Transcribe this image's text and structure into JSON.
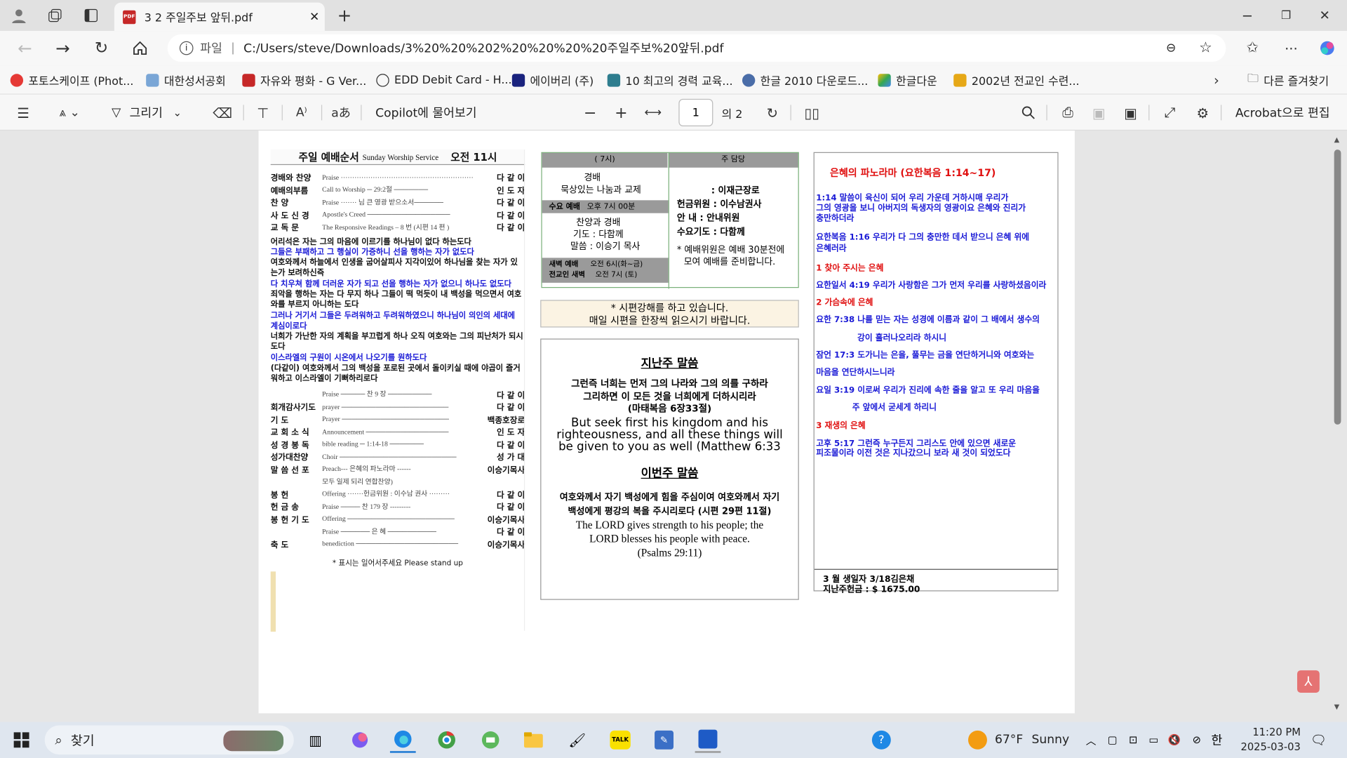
{
  "browser": {
    "tab_title": "3 2 주일주보 앞뒤.pdf",
    "address_prefix": "파일",
    "url": "C:/Users/steve/Downloads/3%20%20%202%20%20%20%20주일주보%20앞뒤.pdf"
  },
  "favorites": [
    "포토스케이프 (Phot...",
    "대한성서공회",
    "자유와 평화 - G Ver...",
    "EDD Debit Card - H...",
    "에이버리 (주)",
    "10 최고의 경력 교육...",
    "한글 2010 다운로드...",
    "한글다운",
    "2002년 전교인 수련...",
    "다른 즐겨찾기"
  ],
  "pdf_toolbar": {
    "draw": "그리기",
    "copilot": "Copilot에 물어보기",
    "page": "1",
    "of_pages": "의 2",
    "acrobat": "Acrobat으로 편집"
  },
  "left": {
    "header_title": "주일 예배순서",
    "header_en": "Sunday Worship Service",
    "header_time": "오전 11시",
    "order1": [
      {
        "a": "경배와 찬양",
        "b": "Praise ··························································",
        "c": "다 같 이"
      },
      {
        "a": "예배의부름",
        "b": "Call to Worship ─          29:2절  ───────",
        "c": "인 도 자"
      },
      {
        "a": "찬     양",
        "b": "Praise ·······   님 큰 영광 받으소서──────",
        "c": "다 같 이"
      },
      {
        "a": "사 도 신 경",
        "b": "Apostle's Creed ─────────────────",
        "c": "다 같 이"
      },
      {
        "a": "교   독   문",
        "b": "The Responsive Readings – 8 번 (시편 14 편 )",
        "c": "다 같 이"
      }
    ],
    "bible": [
      {
        "t": "어리석은 자는 그의 마음에 이르기를 하나님이 없다 하는도다",
        "c": "k"
      },
      {
        "t": "그들은 부패하고 그 행실이 가증하니 선을 행하는 자가 없도다",
        "c": "bl"
      },
      {
        "t": "여호와께서 하늘에서 인생을 굽어살피사 지각이있어 하나님을 찾는 자가 있는가 보려하신즉",
        "c": "k"
      },
      {
        "t": "다 치우쳐 함께 더러운 자가 되고 선을 행하는 자가 없으니 하나도 없도다",
        "c": "bl"
      },
      {
        "t": "죄악을 행하는 자는 다 무지 하나 그들이 떡 먹듯이 내 백성을 먹으면서 여호와를 부르지 아니하는 도다",
        "c": "k"
      },
      {
        "t": "그러나 거기서 그들은 두려워하고 두려워하였으니 하나님이 의인의 세대에 계심이로다",
        "c": "bl"
      },
      {
        "t": "너희가 가난한 자의 계획을 부끄럽게 하나 오직 여호와는 그의 피난처가 되시도다",
        "c": "k"
      },
      {
        "t": "이스라엘의 구원이 시온에서 나오기를 원하도다",
        "c": "bl"
      },
      {
        "t": "(다같이) 여호와께서 그의 백성을 포로된 곳에서 돌이키실 때에 야곱이 즐거워하고 이스라엘이 기뻐하리로다",
        "c": "k"
      }
    ],
    "order2": [
      {
        "a": "",
        "b": "Praise ─────  찬 9 장  ─────────",
        "c": "다 같 이"
      },
      {
        "a": "회개감사기도",
        "b": "prayer ──────────────────────",
        "c": "다 같 이"
      },
      {
        "a": "기       도",
        "b": "Prayer ──────────────────────",
        "c": "백종호장로"
      },
      {
        "a": "교 회 소 식",
        "b": "Announcement ─────────────────",
        "c": "인 도 자"
      },
      {
        "a": "성 경 봉 독",
        "b": "bible reading ─        1:14-18  ───────",
        "c": "다 같 이"
      },
      {
        "a": "성가대찬양",
        "b": "Choir ────────────────────────",
        "c": "성 가 대"
      },
      {
        "a": "말 씀 선 포",
        "b": "Preach--- 은혜의 파노라마 ------",
        "c": "이승기목사"
      },
      {
        "a": "",
        "b": "         모두 일제 되리 연합찬양)",
        "c": ""
      },
      {
        "a": "봉       헌",
        "b": "Offering ·······헌금위원 : 이수남 권사 ·········",
        "c": "다 같 이"
      },
      {
        "a": "헌  금  송",
        "b": "Praise ──── 찬 179 장 ---------",
        "c": "다 같 이"
      },
      {
        "a": "봉 헌 기 도",
        "b": "Offering ──────────────────────",
        "c": "이승기목사"
      },
      {
        "a": "",
        "b": "Praise ──────  은 혜  ──────────",
        "c": "다 같 이"
      },
      {
        "a": "축       도",
        "b": "benediction ─────────────────────",
        "c": "이승기목사"
      }
    ],
    "standup": "* 표시는 일어서주세요 Please stand up"
  },
  "middle": {
    "h1": "(        7시)",
    "h2": "주        담당",
    "c1a": "경배",
    "c1b": "묵상있는 나눔과 교제",
    "wed": "수요 예배",
    "wed_time": "오후 7시 00분",
    "c1c": "찬양과 경배",
    "c1d": "기도 : 다함께",
    "c1e": "말씀 : 이승기 목사",
    "dawn": "새벽 예배",
    "dawn_time": "오전 6시(화~금)",
    "dawn2": "전교인 새벽",
    "dawn2_time": "오전 7시 (토)",
    "r1": ": 이재근장로",
    "r2": "헌금위원 : 이수남권사",
    "r3": "안    내 : 안내위원",
    "r4": "수요기도 : 다함께",
    "r5": "* 예배위원은 예배 30분전에",
    "r6": "모여 예배를 준비합니다.",
    "notice1": "*            시편강해를 하고 있습니다.",
    "notice2": "매일 시편을 한장씩 읽으시기 바랍니다.",
    "last_title": "지난주 말씀",
    "last_k1": "그런즉 너희는 먼저 그의 나라와 그의 의를 구하라",
    "last_k2": "그리하면 이 모든 것을 너희에게 더하시리라",
    "last_ref": "(마태복음 6장33절)",
    "last_e1": "But seek first his kingdom and his",
    "last_e2": "righteousness, and all these things will",
    "last_e3": "be given to you as well (Matthew 6:33",
    "this_title": "이번주 말씀",
    "this_k1": "여호와께서 자기 백성에게 힘을 주심이여 여호와께서 자기",
    "this_k2": "백성에게 평강의 복을 주시리로다 (시편 29편 11절)",
    "this_e1": "The LORD gives strength to his people; the",
    "this_e2": "LORD blesses his people with peace.",
    "this_e3": "(Psalms 29:11)"
  },
  "right": {
    "title": "은혜의 파노라마 (요한복음 1:14~17)",
    "p1a": "     1:14 말씀이 육신이 되어 우리 가운데 거하시매 우리가",
    "p1b": "그의 영광을 보니 아버지의 독생자의 영광이요 은혜와 진리가",
    "p1c": "충만하더라",
    "p2a": "요한복음 1:16 우리가 다 그의 충만한 데서 받으니 은혜 위에",
    "p2b": "은혜러라",
    "h1": "1 찾아 주시는 은혜",
    "v1": "요한일서 4:19 우리가 사랑함은 그가 먼저 우리를 사랑하셨음이라",
    "h2": "2 가슴속에 은혜",
    "v2a": "요한 7:38 나를 믿는 자는 성경에 이름과 같이 그 배에서 생수의",
    "v2b": "강이 흘러나오리라 하시니",
    "v3a": "잠언 17:3 도가니는 은을, 풀무는 금을 연단하거니와 여호와는",
    "v3b": "마음을 연단하시느니라",
    "v4a": "요일 3:19 이로써 우리가 진리에 속한 줄을 알고 또 우리 마음을",
    "v4b": "주 앞에서 굳세게 하리니",
    "h3": "3 재생의 은혜",
    "v5a": "고후 5:17 그런즉 누구든지 그리스도 안에 있으면 새로운",
    "v5b": "피조물이라 이전 것은 지나갔으니 보라 새 것이 되었도다",
    "bday": "3 월 생일자 3/18김은채",
    "offering": "지난주헌금 : $ 1675.00"
  },
  "taskbar": {
    "search": "찾기",
    "weather_temp": "67°F",
    "weather": "Sunny",
    "ime": "한",
    "time": "11:20 PM",
    "date": "2025-03-03"
  }
}
